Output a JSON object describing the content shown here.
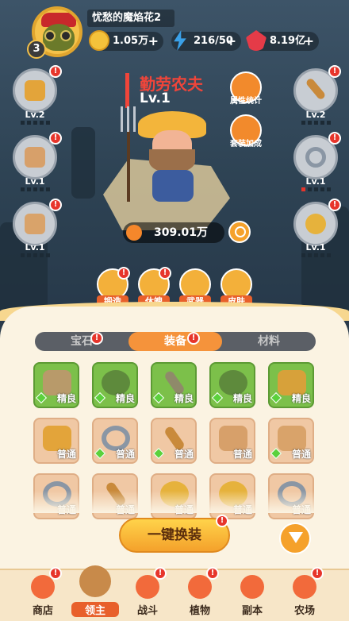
{
  "player": {
    "name": "忧愁的魔焰花2",
    "level": "3"
  },
  "resources": [
    {
      "value": "1.05万",
      "icon": "gold-coin-icon"
    },
    {
      "value": "216/50",
      "icon": "energy-bolt-icon"
    },
    {
      "value": "8.19亿",
      "icon": "red-gem-icon"
    }
  ],
  "hero": {
    "name": "勤劳农夫",
    "level": "Lv.1",
    "power": "309.01万"
  },
  "left_slots": [
    {
      "level": "Lv.2",
      "item": "gold-helmet-icon"
    },
    {
      "level": "Lv.1",
      "item": "armor-icon"
    },
    {
      "level": "Lv.1",
      "item": "pants-icon"
    }
  ],
  "right_slots": [
    {
      "level": "Lv.2",
      "item": "sword-icon"
    },
    {
      "level": "Lv.1",
      "item": "ring-icon"
    },
    {
      "level": "Lv.1",
      "item": "necklace-icon"
    }
  ],
  "right_buttons": [
    {
      "label": "属性统计",
      "icon": "stats-chart-icon"
    },
    {
      "label": "套装加成",
      "icon": "set-bonus-icon"
    }
  ],
  "actions": [
    {
      "label": "锻造",
      "icon": "hammer-icon"
    },
    {
      "label": "休魄",
      "icon": "soul-icon"
    },
    {
      "label": "武器",
      "icon": "weapon-icon"
    },
    {
      "label": "皮肤",
      "icon": "skin-icon"
    }
  ],
  "tabs": [
    {
      "label": "宝石"
    },
    {
      "label": "装备"
    },
    {
      "label": "材料"
    }
  ],
  "inventory": [
    [
      {
        "q": "精良"
      },
      {
        "q": "精良"
      },
      {
        "q": "精良"
      },
      {
        "q": "精良"
      },
      {
        "q": "精良"
      }
    ],
    [
      {
        "q": "普通"
      },
      {
        "q": "普通"
      },
      {
        "q": "普通"
      },
      {
        "q": "普通"
      },
      {
        "q": "普通"
      }
    ],
    [
      {
        "q": "普通"
      },
      {
        "q": "普通"
      },
      {
        "q": "普通"
      },
      {
        "q": "普通"
      },
      {
        "q": "普通"
      }
    ]
  ],
  "equip_all_label": "一键换装",
  "nav": [
    {
      "label": "商店"
    },
    {
      "label": "领主"
    },
    {
      "label": "战斗"
    },
    {
      "label": "植物"
    },
    {
      "label": "副本"
    },
    {
      "label": "农场"
    }
  ],
  "colors": {
    "accent": "#f5933b",
    "alert": "#e7352b",
    "quality_good": "#7cc04a",
    "quality_normal": "#f0c8a4"
  }
}
